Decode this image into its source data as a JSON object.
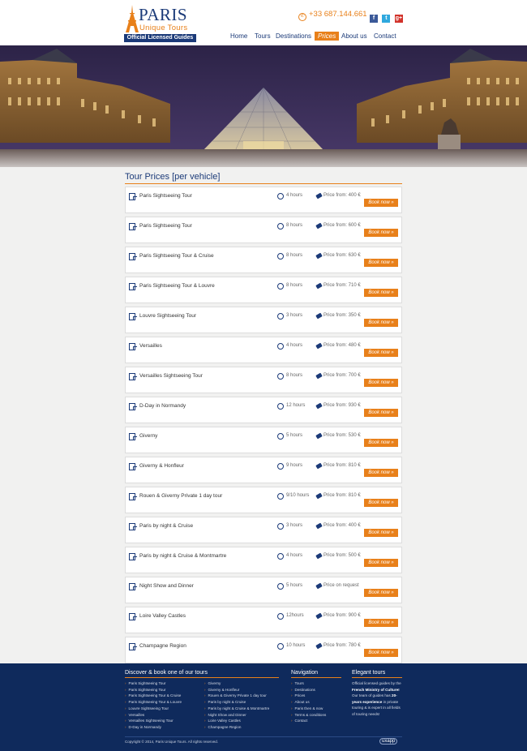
{
  "brand": {
    "name": "PARIS",
    "tagline": "Unique Tours",
    "badge": "Official Licensed Guides"
  },
  "header": {
    "phone": "+33 687.144.661",
    "social": [
      "f",
      "t",
      "g+"
    ],
    "nav": [
      "Home",
      "Tours",
      "Destinations",
      "Prices",
      "About us",
      "Contact"
    ],
    "active_nav": "Prices"
  },
  "page": {
    "title": "Tour Prices [per vehicle]"
  },
  "tours": [
    {
      "name": "Paris Sightseeing Tour",
      "duration": "4 hours",
      "price": "Price from: 400 €",
      "cta": "Book now »"
    },
    {
      "name": "Paris Sightseeing Tour",
      "duration": "8 hours",
      "price": "Price from: 600 €",
      "cta": "Book now »"
    },
    {
      "name": "Paris Sightseeing Tour & Cruise",
      "duration": "8 hours",
      "price": "Price from: 630 €",
      "cta": "Book now »"
    },
    {
      "name": "Paris Sightseeing Tour & Louvre",
      "duration": "8 hours",
      "price": "Price from: 710 €",
      "cta": "Book now »"
    },
    {
      "name": "Louvre Sightseeing Tour",
      "duration": "3 hours",
      "price": "Price from: 350 €",
      "cta": "Book now »"
    },
    {
      "name": "Versailles",
      "duration": "4 hours",
      "price": "Price from: 480 €",
      "cta": "Book now »"
    },
    {
      "name": "Versailles Sightseeing Tour",
      "duration": "8 hours",
      "price": "Price from: 700 €",
      "cta": "Book now »"
    },
    {
      "name": "D-Day in Normandy",
      "duration": "12 hours",
      "price": "Price from: 930 €",
      "cta": "Book now »"
    },
    {
      "name": "Giverny",
      "duration": "5 hours",
      "price": "Price from: 530 €",
      "cta": "Book now »"
    },
    {
      "name": "Giverny & Honfleur",
      "duration": "9 hours",
      "price": "Price from: 810 €",
      "cta": "Book now »"
    },
    {
      "name": "Rouen & Giverny Private 1 day tour",
      "duration": "9/10 hours",
      "price": "Price from: 810 €",
      "cta": "Book now »"
    },
    {
      "name": "Paris by night & Cruise",
      "duration": "3 hours",
      "price": "Price from: 400 €",
      "cta": "Book now »"
    },
    {
      "name": "Paris by night & Cruise & Montmartre",
      "duration": "4 hours",
      "price": "Price from: 500 €",
      "cta": "Book now »"
    },
    {
      "name": "Night Show and Dinner",
      "duration": "5 hours",
      "price": "Price on request",
      "cta": "Book now »"
    },
    {
      "name": "Loire Valley Castles",
      "duration": "12hours",
      "price": "Price from: 900 €",
      "cta": "Book now »"
    },
    {
      "name": "Champagne Region",
      "duration": "10 hours",
      "price": "Price from: 780 €",
      "cta": "Book now »"
    }
  ],
  "footer": {
    "discover_title": "Discover & book one of our tours",
    "discover_col1": [
      "Paris Sightseeing Tour",
      "Paris Sightseeing Tour",
      "Paris Sightseeing Tour & Cruise",
      "Paris Sightseeing Tour & Louvre",
      "Louvre Sightseeing Tour",
      "Versailles",
      "Versailles Sightseeing Tour",
      "D-Day in Normandy"
    ],
    "discover_col2": [
      "Giverny",
      "Giverny & Honfleur",
      "Rouen & Giverny Private 1 day tour",
      "Paris by night & Cruise",
      "Paris by night & Cruise & Montmartre",
      "Night Show and Dinner",
      "Loire Valley Castles",
      "Champagne Region"
    ],
    "navigation_title": "Navigation",
    "navigation": [
      "Tours",
      "Destinations",
      "Prices",
      "About us",
      "Paris then & now",
      "Terms & conditions",
      "Contact"
    ],
    "elegant_title": "Elegant tours",
    "elegant_a": "Official licensed guides by the ",
    "elegant_b": "French Ministry of Culture!",
    "elegant_c": " Our team of guides has ",
    "elegant_d": "20-years experience",
    "elegant_e": " in private touring & is expert in all fields of touring needs!",
    "copyright": "Copyright © 2014, Paris Unique Tours. All rights reserved.",
    "credit": "uxapp"
  }
}
